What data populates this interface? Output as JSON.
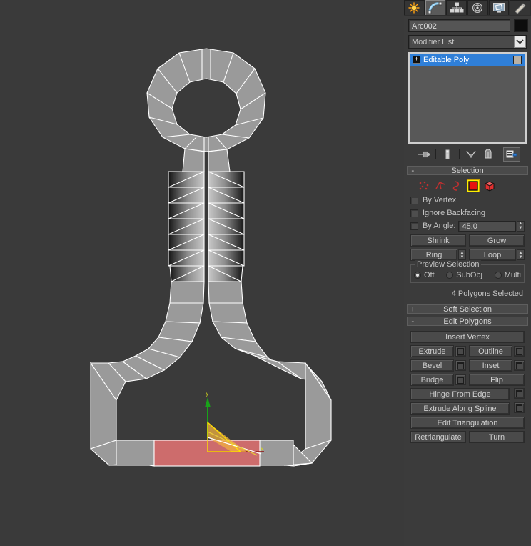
{
  "tabbar": {
    "tabs": [
      {
        "name": "create",
        "icon": "star-icon",
        "active": false
      },
      {
        "name": "modify",
        "icon": "arc-icon",
        "active": true
      },
      {
        "name": "hierarchy",
        "icon": "hierarchy-icon",
        "active": false
      },
      {
        "name": "motion",
        "icon": "motion-icon",
        "active": false
      },
      {
        "name": "display",
        "icon": "display-icon",
        "active": false
      },
      {
        "name": "utilities",
        "icon": "hammer-icon",
        "active": false
      }
    ]
  },
  "object": {
    "name_value": "Arc002",
    "color_swatch": "#0d0d0d"
  },
  "modifier_list": {
    "label": "Modifier List",
    "dropdown_icon": "chevron-down-icon",
    "stack": [
      {
        "label": "Editable Poly",
        "expander": "+",
        "selected": true
      }
    ]
  },
  "stack_tools": [
    {
      "name": "pin-stack-icon"
    },
    {
      "name": "show-end-result-icon"
    },
    {
      "name": "make-unique-icon"
    },
    {
      "name": "remove-modifier-icon"
    },
    {
      "name": "configure-modifier-sets-icon"
    }
  ],
  "selection_rollout": {
    "title": "Selection",
    "expander": "-",
    "subobject_icons": [
      {
        "name": "vertex-icon",
        "selected": false
      },
      {
        "name": "edge-icon",
        "selected": false
      },
      {
        "name": "border-icon",
        "selected": false
      },
      {
        "name": "polygon-icon",
        "selected": true
      },
      {
        "name": "element-icon",
        "selected": false
      }
    ],
    "by_vertex_label": "By Vertex",
    "by_vertex_checked": false,
    "ignore_backfacing_label": "Ignore Backfacing",
    "ignore_backfacing_checked": false,
    "by_angle_label": "By Angle:",
    "by_angle_checked": false,
    "by_angle_value": "45.0",
    "shrink_label": "Shrink",
    "grow_label": "Grow",
    "ring_label": "Ring",
    "loop_label": "Loop",
    "preview_group_title": "Preview Selection",
    "preview_options": [
      {
        "label": "Off",
        "selected": true
      },
      {
        "label": "SubObj",
        "selected": false
      },
      {
        "label": "Multi",
        "selected": false
      }
    ],
    "status": "4 Polygons Selected"
  },
  "soft_selection_rollout": {
    "title": "Soft Selection",
    "expander": "+"
  },
  "edit_polygons_rollout": {
    "title": "Edit Polygons",
    "expander": "-",
    "insert_vertex_label": "Insert Vertex",
    "extrude_label": "Extrude",
    "outline_label": "Outline",
    "bevel_label": "Bevel",
    "inset_label": "Inset",
    "bridge_label": "Bridge",
    "flip_label": "Flip",
    "hinge_from_edge_label": "Hinge From Edge",
    "extrude_along_spline_label": "Extrude Along Spline",
    "edit_triangulation_label": "Edit Triangulation",
    "retriangulate_label": "Retriangulate",
    "turn_label": "Turn"
  },
  "viewport": {
    "background_color": "#3a3a3a",
    "mesh_fill": "#9a9a9a",
    "wireframe_color": "#ffffff",
    "selected_face_color": "#cd6c6c",
    "gizmo": {
      "x_axis_label": "x",
      "y_axis_label": "y",
      "x_axis_color": "#aa1111",
      "y_axis_color": "#19a319",
      "active_color": "#ffe000"
    }
  }
}
